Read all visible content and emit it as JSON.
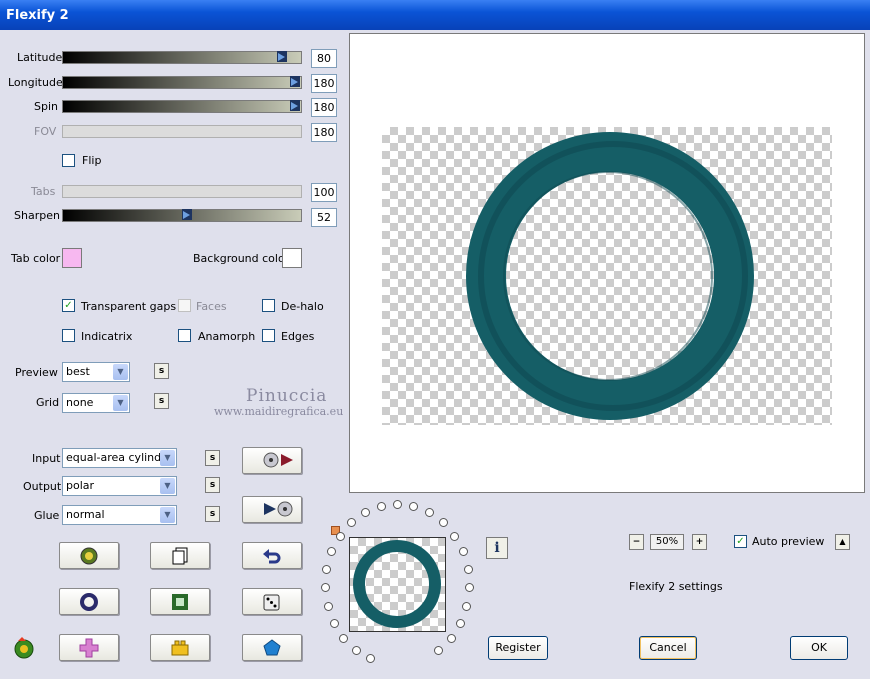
{
  "window": {
    "title": "Flexify 2"
  },
  "params": {
    "latitude": {
      "label": "Latitude",
      "value": "80",
      "level": 0.89
    },
    "longitude": {
      "label": "Longitude",
      "value": "180",
      "level": 1.0
    },
    "spin": {
      "label": "Spin",
      "value": "180",
      "level": 1.0
    },
    "fov": {
      "label": "FOV",
      "value": "180"
    },
    "flip": {
      "label": "Flip",
      "checked": false
    },
    "tabs": {
      "label": "Tabs",
      "value": "100"
    },
    "sharpen": {
      "label": "Sharpen",
      "value": "52",
      "level": 0.52
    }
  },
  "colors": {
    "tab_color_label": "Tab color",
    "tab_color": "#f7b8f0",
    "bg_color_label": "Background color",
    "bg_color": "#ffffff",
    "ring": "#155e66"
  },
  "options": {
    "transparent_gaps": {
      "label": "Transparent gaps",
      "checked": true
    },
    "faces": {
      "label": "Faces",
      "checked": false
    },
    "dehalo": {
      "label": "De-halo",
      "checked": false
    },
    "indicatrix": {
      "label": "Indicatrix",
      "checked": false
    },
    "anamorph": {
      "label": "Anamorph",
      "checked": false
    },
    "edges": {
      "label": "Edges",
      "checked": false
    }
  },
  "selects": {
    "preview": {
      "label": "Preview",
      "value": "best"
    },
    "grid": {
      "label": "Grid",
      "value": "none"
    },
    "input": {
      "label": "Input",
      "value": "equal-area cylinder"
    },
    "output": {
      "label": "Output",
      "value": "polar"
    },
    "glue": {
      "label": "Glue",
      "value": "normal"
    }
  },
  "small_button_label": "s",
  "watermark": {
    "line1": "Pinuccia",
    "line2": "www.maidiregrafica.eu"
  },
  "zoom": {
    "minus": "−",
    "value": "50%",
    "plus": "+"
  },
  "auto_preview": {
    "label": "Auto preview",
    "checked": true
  },
  "collapse_label": "▲",
  "settings_name": "Flexify 2 settings",
  "info_label": "i",
  "buttons": {
    "register": "Register",
    "cancel": "Cancel",
    "ok": "OK"
  },
  "icons": [
    "gear-icon",
    "copy-icon",
    "undo-icon",
    "ring-icon",
    "square-frame-icon",
    "dice-icon",
    "logo-icon",
    "plus-icon",
    "lego-brick-icon",
    "pentagon-icon",
    "import-icon",
    "export-icon"
  ]
}
